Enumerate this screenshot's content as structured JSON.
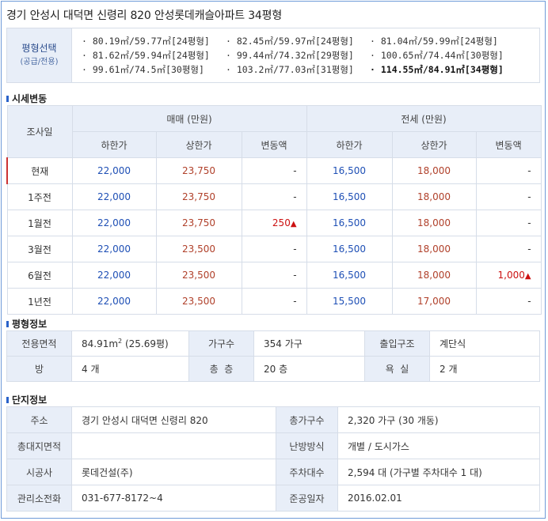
{
  "title": "경기 안성시 대덕면 신령리 820 안성롯데캐슬아파트 34평형",
  "size_select": {
    "label": "평형선택",
    "sublabel": "(공급/전용)",
    "options": [
      "· 80.19㎡/59.77㎡[24평형]",
      "· 82.45㎡/59.97㎡[24평형]",
      "· 81.04㎡/59.99㎡[24평형]",
      "· 81.62㎡/59.94㎡[24평형]",
      "· 99.44㎡/74.32㎡[29평형]",
      "· 100.65㎡/74.44㎡[30평형]",
      "· 99.61㎡/74.5㎡[30평형]",
      "· 103.2㎡/77.03㎡[31평형]",
      "· 114.55㎡/84.91㎡[34평형]"
    ],
    "selected_index": 8
  },
  "price_section": {
    "title": "시세변동",
    "col_date": "조사일",
    "group_sale": "매매 (만원)",
    "group_jeonse": "전세 (만원)",
    "col_low": "하한가",
    "col_high": "상한가",
    "col_change": "변동액",
    "rows": [
      {
        "date": "현재",
        "s_low": "22,000",
        "s_high": "23,750",
        "s_chg": "-",
        "j_low": "16,500",
        "j_high": "18,000",
        "j_chg": "-"
      },
      {
        "date": "1주전",
        "s_low": "22,000",
        "s_high": "23,750",
        "s_chg": "-",
        "j_low": "16,500",
        "j_high": "18,000",
        "j_chg": "-"
      },
      {
        "date": "1월전",
        "s_low": "22,000",
        "s_high": "23,750",
        "s_chg": "250",
        "j_low": "16,500",
        "j_high": "18,000",
        "j_chg": "-"
      },
      {
        "date": "3월전",
        "s_low": "22,000",
        "s_high": "23,500",
        "s_chg": "-",
        "j_low": "16,500",
        "j_high": "18,000",
        "j_chg": "-"
      },
      {
        "date": "6월전",
        "s_low": "22,000",
        "s_high": "23,500",
        "s_chg": "-",
        "j_low": "16,500",
        "j_high": "18,000",
        "j_chg": "1,000"
      },
      {
        "date": "1년전",
        "s_low": "22,000",
        "s_high": "23,500",
        "s_chg": "-",
        "j_low": "15,500",
        "j_high": "17,000",
        "j_chg": "-"
      }
    ],
    "up_mark": "▲",
    "colors": {
      "low": "#1e4fb5",
      "high": "#b0402a",
      "up": "#cc1111"
    }
  },
  "unit_info": {
    "title": "평형정보",
    "exclusive_area_label": "전용면적",
    "exclusive_area_value": "84.91m",
    "exclusive_area_sup": "2",
    "exclusive_area_pyeong": "(25.69평)",
    "households_label": "가구수",
    "households_value": "354 가구",
    "entrance_label": "출입구조",
    "entrance_value": "계단식",
    "rooms_label": "방",
    "rooms_value": "4 개",
    "floors_label": "총  층",
    "floors_value": "20 층",
    "bath_label": "욕  실",
    "bath_value": "2 개"
  },
  "complex_info": {
    "title": "단지정보",
    "address_label": "주소",
    "address_value": "경기 안성시 대덕면 신령리 820",
    "total_households_label": "총가구수",
    "total_households_value": "2,320 가구 (30 개동)",
    "land_area_label": "총대지면적",
    "land_area_value": "",
    "heating_label": "난방방식",
    "heating_value": "개별 / 도시가스",
    "builder_label": "시공사",
    "builder_value": "롯데건설(주)",
    "parking_label": "주차대수",
    "parking_value": "2,594 대 (가구별 주차대수 1 대)",
    "office_phone_label": "관리소전화",
    "office_phone_value": "031-677-8172~4",
    "completion_label": "준공일자",
    "completion_value": "2016.02.01"
  }
}
